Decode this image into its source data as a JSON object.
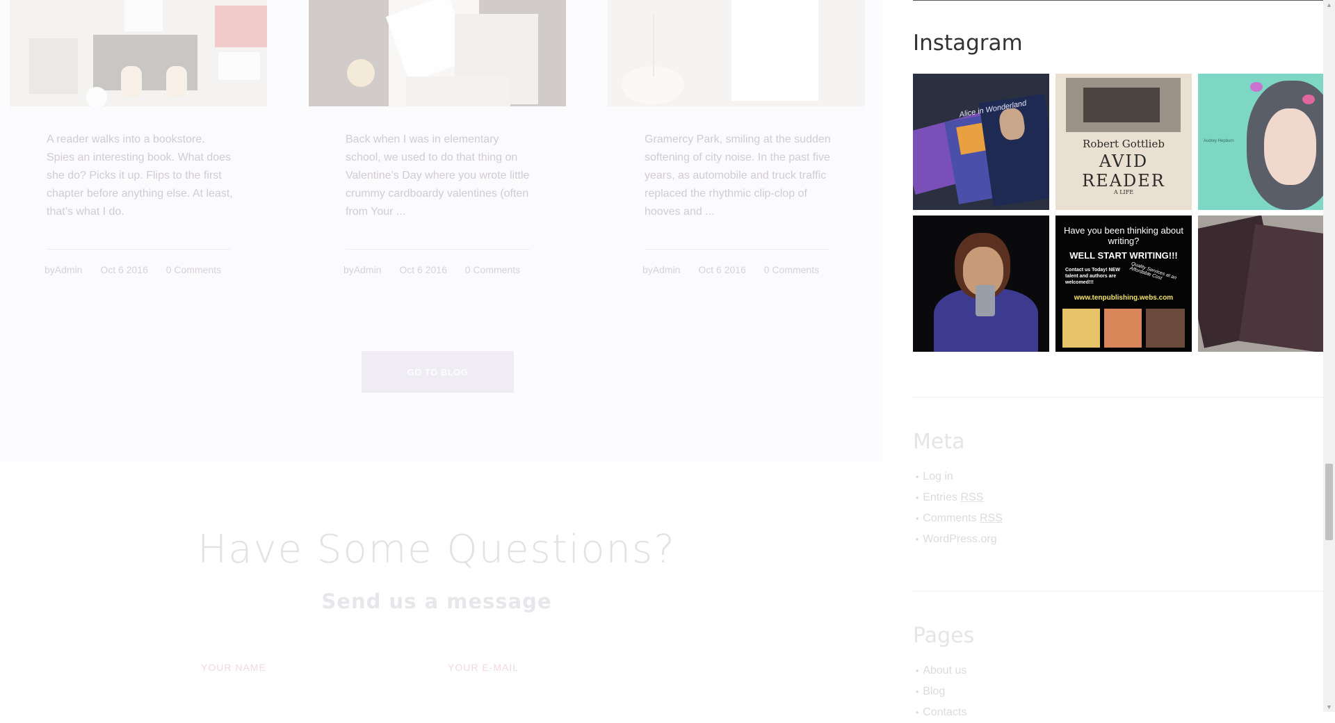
{
  "blog_cards": [
    {
      "excerpt": "A reader walks into a bookstore. Spies an interesting book. What does she do? Picks it up. Flips to the first chapter before anything else. At least, that’s what I do.",
      "author": "byAdmin",
      "date": "Oct 6 2016",
      "comments": "0 Comments"
    },
    {
      "excerpt": "Back when I was in elementary school, we used to do that thing on Valentine’s Day where you wrote little crummy cardboardy valentines (often from Your ...",
      "author": "byAdmin",
      "date": "Oct 6 2016",
      "comments": "0 Comments"
    },
    {
      "excerpt": "Gramercy Park, smiling at the sudden softening of city noise. In the past five years, as automobile and truck traffic replaced the rhythmic clip-clop of hooves and ...",
      "author": "byAdmin",
      "date": "Oct 6 2016",
      "comments": "0 Comments"
    }
  ],
  "go_to_blog_label": "GO TO BLOG",
  "contact": {
    "title": "Have Some Questions?",
    "subtitle": "Send us a message",
    "name_placeholder": "YOUR NAME",
    "email_placeholder": "YOUR E-MAIL"
  },
  "sidebar": {
    "instagram_title": "Instagram",
    "instagram_photos": [
      {
        "title_text": "Alice in Wonderland"
      },
      {
        "author": "Robert Gottlieb",
        "title": "AVID READER",
        "subtitle": "A LIFE"
      },
      {
        "caption": "Audrey Hepburn"
      },
      {},
      {
        "line1": "Have you been thinking about writing?",
        "line2": "WELL START WRITING!!!",
        "line3": "Contact us Today! NEW talent and authors are welcomed!!!",
        "line4": "Quality Services at an Affordable Cost",
        "url": "www.tenpublishing.webs.com"
      },
      {}
    ],
    "meta_title": "Meta",
    "meta_links": [
      {
        "text": "Log in"
      },
      {
        "text": "Entries ",
        "abbr": "RSS"
      },
      {
        "text": "Comments ",
        "abbr": "RSS"
      },
      {
        "text": "WordPress.org"
      }
    ],
    "pages_title": "Pages",
    "pages_links": [
      "About us",
      "Blog",
      "Contacts"
    ]
  }
}
